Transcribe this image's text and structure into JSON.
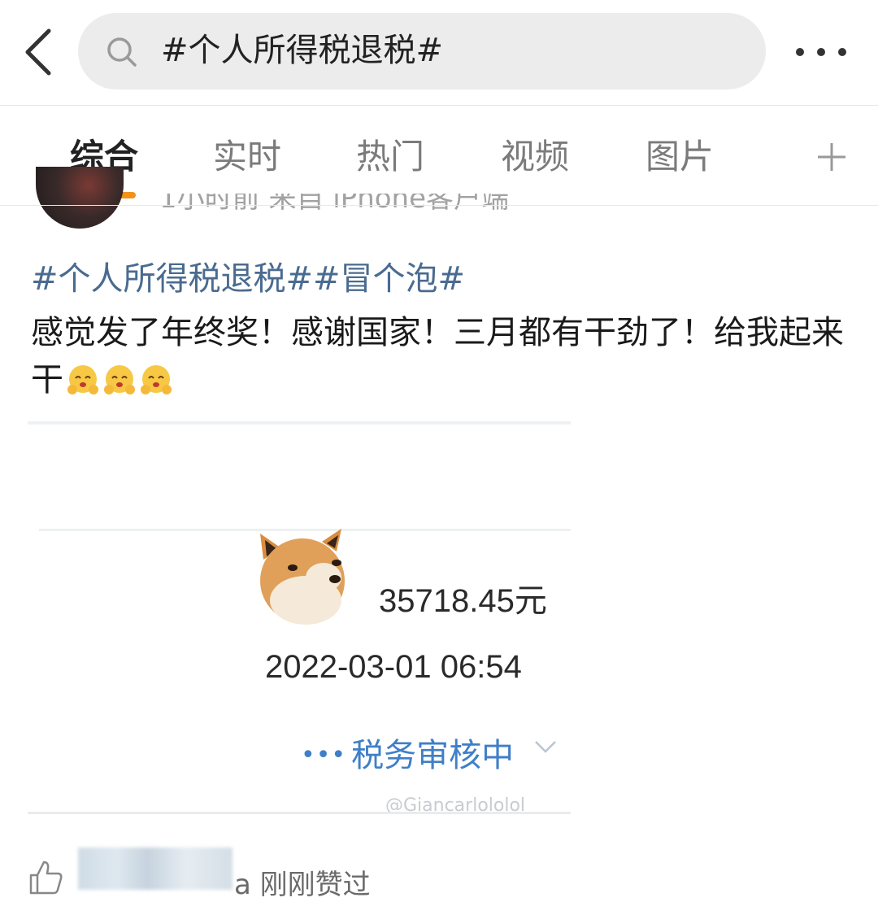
{
  "search": {
    "query": "#个人所得税退税#"
  },
  "tabs": [
    {
      "label": "综合",
      "active": true
    },
    {
      "label": "实时",
      "active": false
    },
    {
      "label": "热门",
      "active": false
    },
    {
      "label": "视频",
      "active": false
    },
    {
      "label": "图片",
      "active": false
    }
  ],
  "post": {
    "meta": "1小时前  来自 iPhone客户端",
    "hashtags": "#个人所得税退税##冒个泡#",
    "text": "感觉发了年终奖！感谢国家！三月都有干劲了！给我起来干",
    "emoji_count": 3
  },
  "screenshot": {
    "amount": "35718.45元",
    "datetime": "2022-03-01 06:54",
    "status": "税务审核中",
    "watermark": "@Giancarlololol"
  },
  "likes": {
    "user_suffix": "a",
    "label": "刚刚赞过"
  },
  "colors": {
    "accent": "#f29218",
    "link": "#4a6b90",
    "status_blue": "#3f7fc8"
  }
}
